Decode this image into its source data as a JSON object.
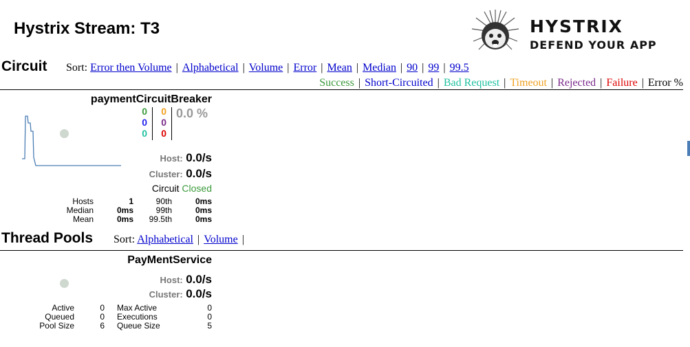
{
  "page_title": "Hystrix Stream: T3",
  "logo": {
    "line1": "HYSTRIX",
    "line2": "DEFEND YOUR APP"
  },
  "circuit_section": {
    "heading": "Circuit",
    "sort_label": "Sort:",
    "sort_options": [
      "Error then Volume",
      "Alphabetical",
      "Volume",
      "Error",
      "Mean",
      "Median",
      "90",
      "99",
      "99.5"
    ],
    "legend": [
      {
        "label": "Success",
        "color": "#3b9a3b"
      },
      {
        "label": "Short-Circuited",
        "color": "#0000cc"
      },
      {
        "label": "Bad Request",
        "color": "#1fc0a0"
      },
      {
        "label": "Timeout",
        "color": "#f0a020"
      },
      {
        "label": "Rejected",
        "color": "#7a2a8a"
      },
      {
        "label": "Failure",
        "color": "#dd0000"
      },
      {
        "label": "Error %",
        "color": "#000000"
      }
    ]
  },
  "circuit": {
    "name": "paymentCircuitBreaker",
    "counts_left": [
      {
        "value": "0",
        "color": "#3b9a3b"
      },
      {
        "value": "0",
        "color": "#2222ee"
      },
      {
        "value": "0",
        "color": "#1fc0a0"
      }
    ],
    "counts_right": [
      {
        "value": "0",
        "color": "#f0a020"
      },
      {
        "value": "0",
        "color": "#7a2a8a"
      },
      {
        "value": "0",
        "color": "#dd0000"
      }
    ],
    "error_percent": "0.0 %",
    "host_label": "Host:",
    "host_rate": "0.0/s",
    "cluster_label": "Cluster:",
    "cluster_rate": "0.0/s",
    "circuit_label": "Circuit",
    "circuit_status": "Closed",
    "circuit_status_color": "#3b9a3b",
    "stats": {
      "hosts_label": "Hosts",
      "hosts": "1",
      "median_label": "Median",
      "median": "0ms",
      "mean_label": "Mean",
      "mean": "0ms",
      "p90_label": "90th",
      "p90": "0ms",
      "p99_label": "99th",
      "p99": "0ms",
      "p995_label": "99.5th",
      "p995": "0ms"
    }
  },
  "thread_section": {
    "heading": "Thread Pools",
    "sort_label": "Sort:",
    "sort_options": [
      "Alphabetical",
      "Volume"
    ]
  },
  "thread_pool": {
    "name": "PayMentService",
    "host_label": "Host:",
    "host_rate": "0.0/s",
    "cluster_label": "Cluster:",
    "cluster_rate": "0.0/s",
    "stats": {
      "active_label": "Active",
      "active": "0",
      "queued_label": "Queued",
      "queued": "0",
      "pool_size_label": "Pool Size",
      "pool_size": "6",
      "max_active_label": "Max Active",
      "max_active": "0",
      "executions_label": "Executions",
      "executions": "0",
      "queue_size_label": "Queue Size",
      "queue_size": "5"
    }
  }
}
